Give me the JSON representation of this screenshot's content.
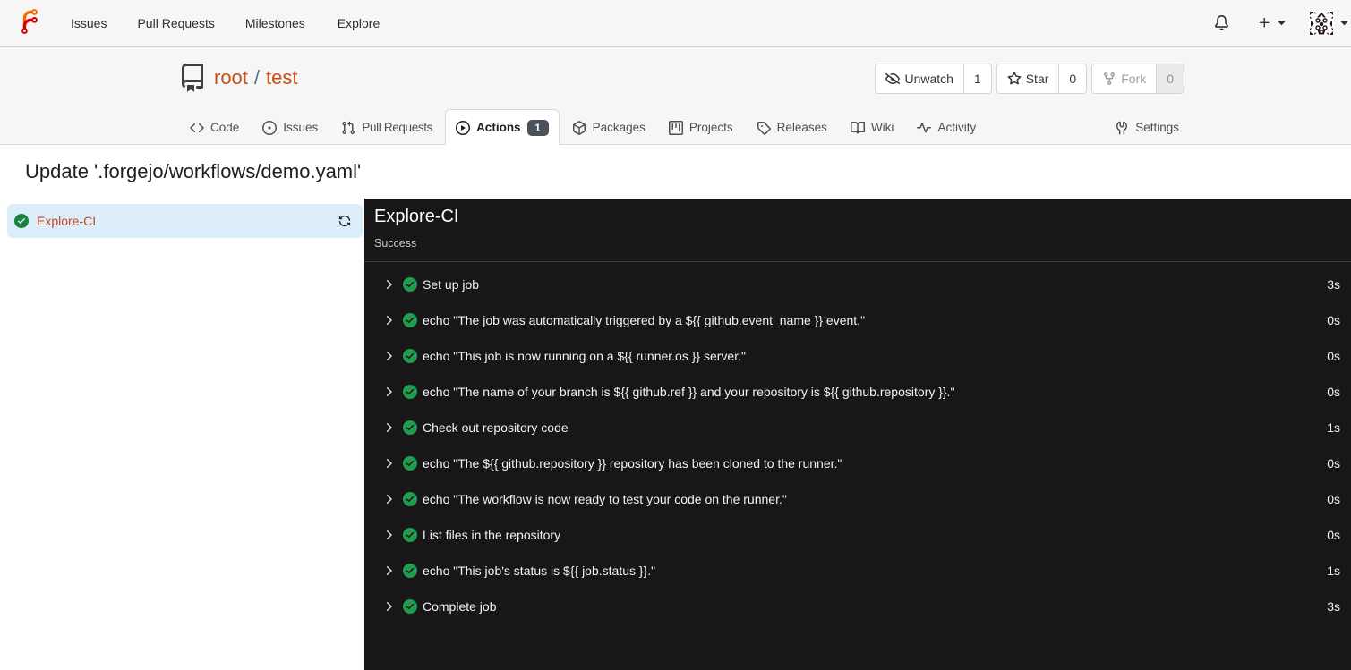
{
  "navbar": {
    "items": [
      {
        "label": "Issues"
      },
      {
        "label": "Pull Requests"
      },
      {
        "label": "Milestones"
      },
      {
        "label": "Explore"
      }
    ]
  },
  "repo": {
    "owner": "root",
    "separator": "/",
    "name": "test",
    "watch": {
      "label": "Unwatch",
      "count": "1"
    },
    "star": {
      "label": "Star",
      "count": "0"
    },
    "fork": {
      "label": "Fork",
      "count": "0"
    }
  },
  "tabs": [
    {
      "label": "Code"
    },
    {
      "label": "Issues"
    },
    {
      "label": "Pull Requests"
    },
    {
      "label": "Actions",
      "badge": "1",
      "active": true
    },
    {
      "label": "Packages"
    },
    {
      "label": "Projects"
    },
    {
      "label": "Releases"
    },
    {
      "label": "Wiki"
    },
    {
      "label": "Activity"
    },
    {
      "label": "Settings"
    }
  ],
  "run": {
    "title": "Update '.forgejo/workflows/demo.yaml'",
    "jobs": [
      {
        "name": "Explore-CI",
        "status": "success"
      }
    ],
    "panel": {
      "title": "Explore-CI",
      "status": "Success",
      "steps": [
        {
          "label": "Set up job",
          "duration": "3s"
        },
        {
          "label": "echo \"The job was automatically triggered by a ${{ github.event_name }} event.\"",
          "duration": "0s"
        },
        {
          "label": "echo \"This job is now running on a ${{ runner.os }} server.\"",
          "duration": "0s"
        },
        {
          "label": "echo \"The name of your branch is ${{ github.ref }} and your repository is ${{ github.repository }}.\"",
          "duration": "0s"
        },
        {
          "label": "Check out repository code",
          "duration": "1s"
        },
        {
          "label": "echo \"The ${{ github.repository }} repository has been cloned to the runner.\"",
          "duration": "0s"
        },
        {
          "label": "echo \"The workflow is now ready to test your code on the runner.\"",
          "duration": "0s"
        },
        {
          "label": "List files in the repository",
          "duration": "0s"
        },
        {
          "label": "echo \"This job's status is ${{ job.status }}.\"",
          "duration": "1s"
        },
        {
          "label": "Complete job",
          "duration": "3s"
        }
      ]
    }
  },
  "colors": {
    "accent_orange": "#c75017",
    "job_link_orange": "#c04a20",
    "success_green_light": "#17833c",
    "success_green_dark_panel": "#209d50",
    "panel_bg": "#171717",
    "selected_job_bg": "#ddeefb",
    "badge_bg": "#48515c",
    "header_bg": "#f6f6f6"
  }
}
